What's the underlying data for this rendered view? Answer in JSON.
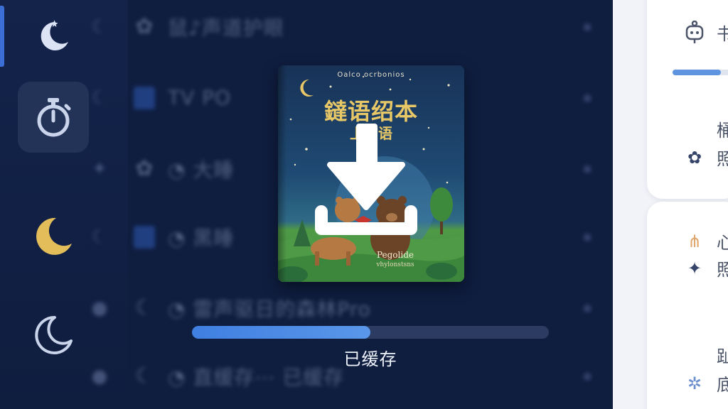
{
  "rail": {
    "items": [
      {
        "icon": "moon-star-icon",
        "active": false
      },
      {
        "icon": "stopwatch-icon",
        "active": true
      },
      {
        "icon": "crescent-moon-filled-icon",
        "active": false
      },
      {
        "icon": "crescent-moon-outline-icon",
        "active": false
      }
    ],
    "colors": {
      "indicator": "#3c6fd6",
      "active_bg": "#233358",
      "moon_fill": "#e2bd5a"
    }
  },
  "list": {
    "rows": [
      {
        "mini": "☾",
        "icon": "gear-icon",
        "glyph": "✿",
        "name": "鼠♪声道护眼"
      },
      {
        "mini": "☾",
        "icon": "tv-icon",
        "glyph": "",
        "name": "TV PO"
      },
      {
        "mini": "✦",
        "icon": "gear-icon",
        "glyph": "✿",
        "name": "◔ 大睡"
      },
      {
        "mini": "☾",
        "icon": "app-icon",
        "glyph": "",
        "name": "◔ 黑睡"
      },
      {
        "mini": "●",
        "icon": "moon-icon",
        "glyph": "☾",
        "name": "◔ 雷声驱日的森林Pro"
      },
      {
        "mini": "●",
        "icon": "moon-icon",
        "glyph": "☾",
        "name": "◔ 直缓存⋯ 已缓存"
      }
    ]
  },
  "side": {
    "top_label": "书",
    "lines": [
      {
        "icon": "",
        "text": "桶 市"
      },
      {
        "icon": "✿",
        "text": "照"
      },
      {
        "icon": "⋔",
        "text": "心"
      },
      {
        "icon": "✦",
        "text": "照"
      },
      {
        "icon": "",
        "text": "趾 "
      },
      {
        "icon": "✲",
        "text": "底"
      }
    ],
    "tab_progress": 0.85
  },
  "modal": {
    "book": {
      "kicker": "Oalco ocrbonios",
      "title": "鐽语绍本",
      "subtitle": "上布语",
      "footer_title": "Pegolide",
      "footer_sub": "vhylonstsns"
    },
    "download_icon": "download-arrow-icon",
    "progress": 0.5,
    "status_text": "已缓存"
  }
}
